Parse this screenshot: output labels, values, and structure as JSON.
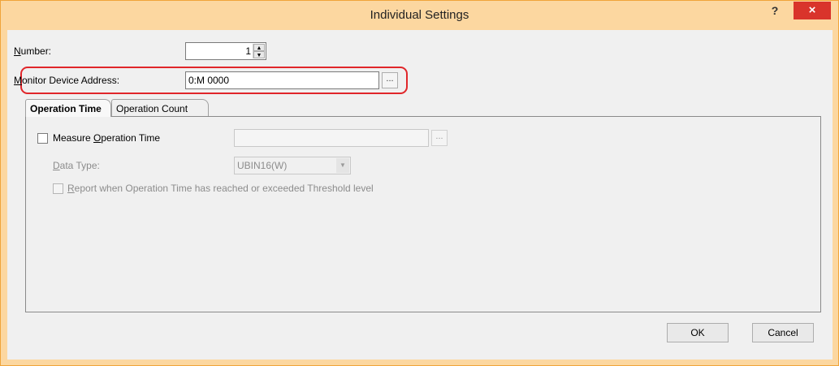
{
  "window": {
    "title": "Individual Settings",
    "help_label": "?",
    "close_label": "×"
  },
  "number": {
    "label_underlined": "N",
    "label_rest": "umber:",
    "value": "1"
  },
  "monitor_address": {
    "label_underlined": "M",
    "label_rest": "onitor Device Address:",
    "value": "0:M 0000",
    "browse_label": "..."
  },
  "tabs": [
    {
      "label": "Operation Time",
      "active": true
    },
    {
      "label": "Operation Count",
      "active": false
    }
  ],
  "operation_time": {
    "measure_label_pre": "Measure ",
    "measure_label_underlined": "O",
    "measure_label_post": "peration Time",
    "measure_checked": false,
    "browse_label": "...",
    "data_type_label_underlined": "D",
    "data_type_label_rest": "ata Type:",
    "data_type_value": "UBIN16(W)",
    "report_label_underlined": "R",
    "report_label_rest": "eport when Operation Time has reached or exceeded Threshold level"
  },
  "footer": {
    "ok_label": "OK",
    "cancel_label": "Cancel"
  },
  "colors": {
    "title_bar": "#fcd7a0",
    "close_button": "#d9342b",
    "highlight": "#e0262a"
  }
}
